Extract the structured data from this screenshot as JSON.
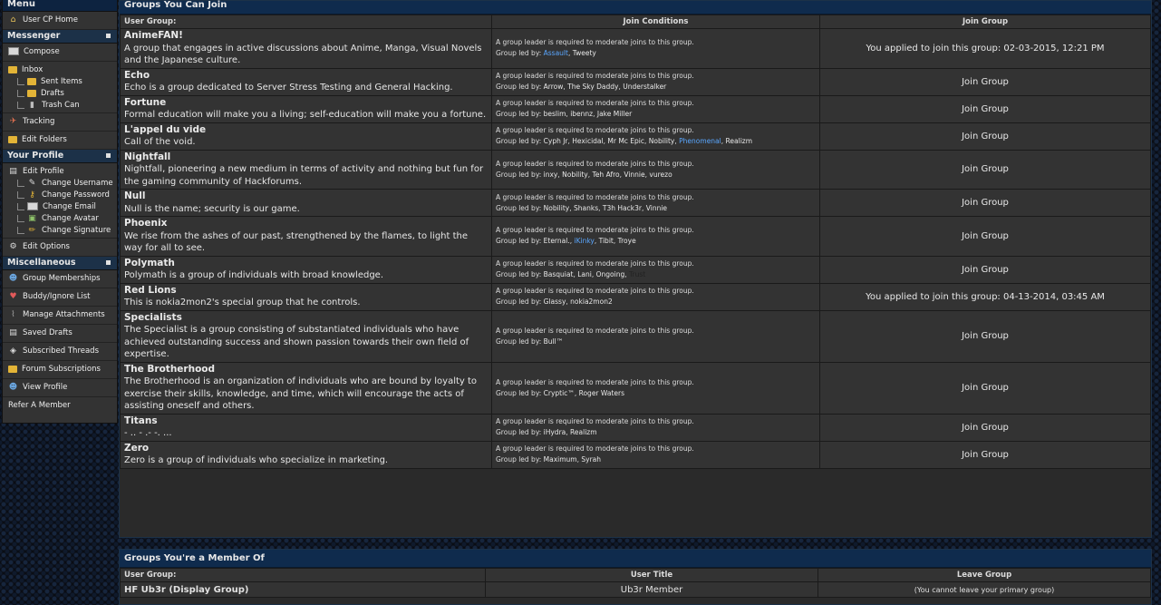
{
  "sidebar": {
    "menu_title": "Menu",
    "home": "User CP Home",
    "messenger": "Messenger",
    "compose": "Compose",
    "inbox": "Inbox",
    "sent_items": "Sent Items",
    "drafts": "Drafts",
    "trash_can": "Trash Can",
    "tracking": "Tracking",
    "edit_folders": "Edit Folders",
    "your_profile": "Your Profile",
    "edit_profile": "Edit Profile",
    "change_username": "Change Username",
    "change_password": "Change Password",
    "change_email": "Change Email",
    "change_avatar": "Change Avatar",
    "change_signature": "Change Signature",
    "edit_options": "Edit Options",
    "miscellaneous": "Miscellaneous",
    "group_memberships": "Group Memberships",
    "buddy_ignore": "Buddy/Ignore List",
    "manage_attachments": "Manage Attachments",
    "saved_drafts": "Saved Drafts",
    "subscribed_threads": "Subscribed Threads",
    "forum_subscriptions": "Forum Subscriptions",
    "view_profile": "View Profile",
    "refer_member": "Refer A Member"
  },
  "join_panel": {
    "title": "Groups You Can Join",
    "col_group": "User Group:",
    "col_conditions": "Join Conditions",
    "col_join": "Join Group",
    "condition_text": "A group leader is required to moderate joins to this group.",
    "led_by_label": "Group led by:",
    "rows": [
      {
        "name": "AnimeFAN!",
        "desc": "A group that engages in active discussions about Anime, Manga, Visual Novels and the Japanese culture.",
        "leaders": [
          {
            "n": "Assault",
            "c": "blue"
          },
          {
            "n": "Tweety",
            "c": ""
          }
        ],
        "action": "You applied to join this group: 02-03-2015, 12:21 PM"
      },
      {
        "name": "Echo",
        "desc": "Echo is a group dedicated to Server Stress Testing and General Hacking.",
        "leaders": [
          {
            "n": "Arrow",
            "c": ""
          },
          {
            "n": "The Sky Daddy",
            "c": ""
          },
          {
            "n": "Understalker",
            "c": ""
          }
        ],
        "action": "Join Group"
      },
      {
        "name": "Fortune",
        "desc": "Formal education will make you a living; self-education will make you a fortune.",
        "leaders": [
          {
            "n": "beslim",
            "c": ""
          },
          {
            "n": "ibennz",
            "c": ""
          },
          {
            "n": "Jake Miller",
            "c": ""
          }
        ],
        "action": "Join Group"
      },
      {
        "name": "L'appel du vide",
        "desc": "Call of the void.",
        "leaders": [
          {
            "n": "Cyph Jr",
            "c": ""
          },
          {
            "n": "Hexicidal",
            "c": ""
          },
          {
            "n": "Mr Mc Epic",
            "c": ""
          },
          {
            "n": "Nobility",
            "c": ""
          },
          {
            "n": "Phenomenal",
            "c": "blue"
          },
          {
            "n": "Realizm",
            "c": ""
          }
        ],
        "action": "Join Group"
      },
      {
        "name": "Nightfall",
        "desc": "Nightfall, pioneering a new medium in terms of activity and nothing but fun for the gaming community of Hackforums.",
        "leaders": [
          {
            "n": "inxy",
            "c": ""
          },
          {
            "n": "Nobility",
            "c": ""
          },
          {
            "n": "Teh Afro",
            "c": ""
          },
          {
            "n": "Vinnie",
            "c": ""
          },
          {
            "n": "vurezo",
            "c": ""
          }
        ],
        "action": "Join Group"
      },
      {
        "name": "Null",
        "desc": "Null is the name; security is our game.",
        "leaders": [
          {
            "n": "Nobility",
            "c": ""
          },
          {
            "n": "Shanks",
            "c": ""
          },
          {
            "n": "T3h Hack3r",
            "c": ""
          },
          {
            "n": "Vinnie",
            "c": ""
          }
        ],
        "action": "Join Group"
      },
      {
        "name": "Phoenix",
        "desc": "We rise from the ashes of our past, strengthened by the flames, to light the way for all to see.",
        "leaders": [
          {
            "n": "Eternal.",
            "c": ""
          },
          {
            "n": "iKinky",
            "c": "blue"
          },
          {
            "n": "Tibit",
            "c": ""
          },
          {
            "n": "Troye",
            "c": ""
          }
        ],
        "action": "Join Group"
      },
      {
        "name": "Polymath",
        "desc": "Polymath is a group of individuals with broad knowledge.",
        "leaders": [
          {
            "n": "Basquiat",
            "c": ""
          },
          {
            "n": "Lani",
            "c": ""
          },
          {
            "n": "Ongoing",
            "c": ""
          },
          {
            "n": "Trust",
            "c": "dim"
          }
        ],
        "action": "Join Group"
      },
      {
        "name": "Red Lions",
        "desc": "This is nokia2mon2's special group that he controls.",
        "leaders": [
          {
            "n": "Glassy",
            "c": ""
          },
          {
            "n": "nokia2mon2",
            "c": ""
          }
        ],
        "action": "You applied to join this group: 04-13-2014, 03:45 AM"
      },
      {
        "name": "Specialists",
        "desc": "The Specialist is a group consisting of substantiated individuals who have achieved outstanding success and shown passion towards their own field of expertise.",
        "leaders": [
          {
            "n": "Bull™",
            "c": ""
          }
        ],
        "action": "Join Group"
      },
      {
        "name": "The Brotherhood",
        "desc": "The Brotherhood is an organization of individuals who are bound by loyalty to exercise their skills, knowledge, and time, which will encourage the acts of assisting oneself and others.",
        "leaders": [
          {
            "n": "Cryptic™",
            "c": ""
          },
          {
            "n": "Roger Waters",
            "c": ""
          }
        ],
        "action": "Join Group"
      },
      {
        "name": "Titans",
        "desc": "- .. - .- -. ...",
        "leaders": [
          {
            "n": "iHydra",
            "c": ""
          },
          {
            "n": "Realizm",
            "c": ""
          }
        ],
        "action": "Join Group"
      },
      {
        "name": "Zero",
        "desc": "Zero is a group of individuals who specialize in marketing.",
        "leaders": [
          {
            "n": "Maximum",
            "c": ""
          },
          {
            "n": "Syrah",
            "c": ""
          }
        ],
        "action": "Join Group"
      }
    ]
  },
  "member_panel": {
    "title": "Groups You're a Member Of",
    "col_group": "User Group:",
    "col_title": "User Title",
    "col_leave": "Leave Group",
    "row_group": "HF Ub3r (Display Group)",
    "row_title": "Ub3r Member",
    "row_leave": "(You cannot leave your primary group)"
  }
}
